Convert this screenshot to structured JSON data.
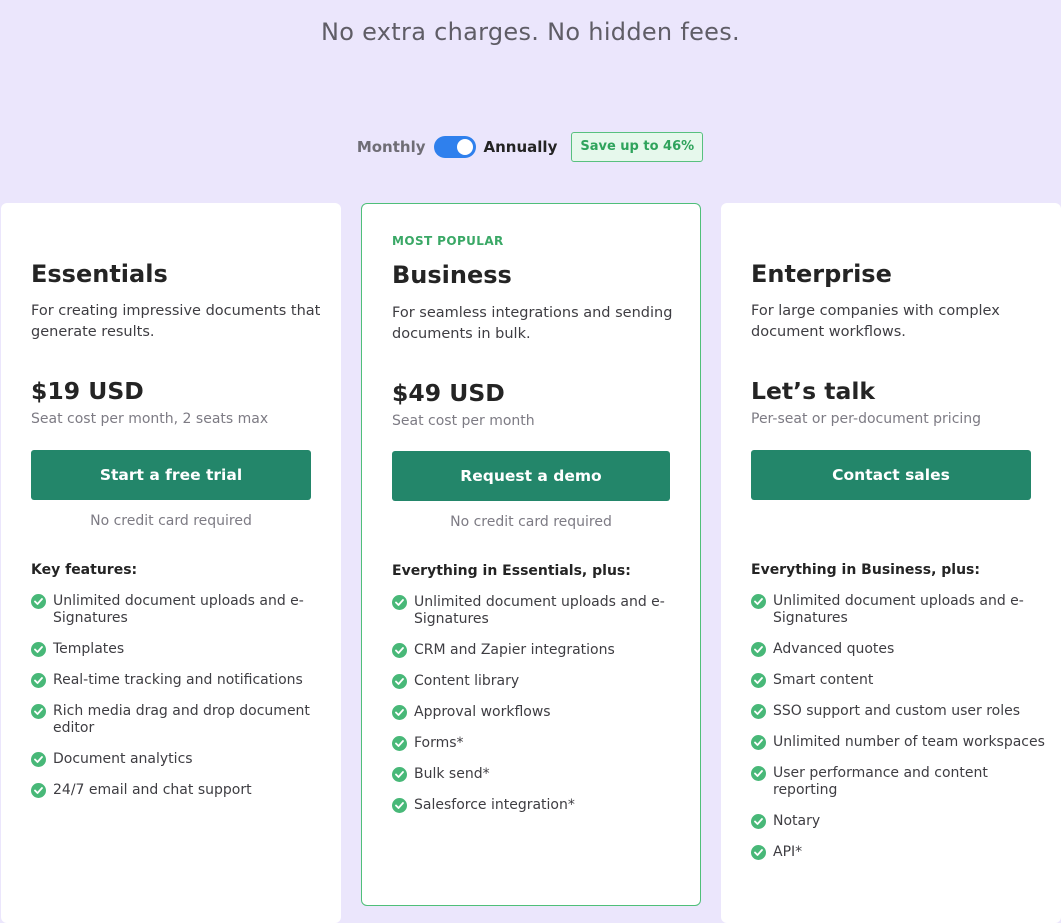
{
  "subtitle": "No extra charges. No hidden fees.",
  "billing": {
    "monthly_label": "Monthly",
    "annually_label": "Annually",
    "save_badge": "Save up to 46%",
    "selected": "Annually"
  },
  "colors": {
    "accent": "#23866a",
    "toggle": "#2f80ed",
    "check": "#48b878",
    "background": "#ebe6fc"
  },
  "plans": [
    {
      "badge": "",
      "name": "Essentials",
      "description": "For creating impressive documents that generate results.",
      "price": "$19 USD",
      "price_note": "Seat cost per month, 2 seats max",
      "cta": "Start a free trial",
      "cta_note": "No credit card required",
      "features_heading": "Key features:",
      "features": [
        "Unlimited document uploads and e-Signatures",
        "Templates",
        "Real-time tracking and notifications",
        "Rich media drag and drop document editor",
        "Document analytics",
        "24/7 email and chat support"
      ]
    },
    {
      "badge": "MOST POPULAR",
      "name": "Business",
      "description": "For seamless integrations and sending documents in bulk.",
      "price": "$49 USD",
      "price_note": "Seat cost per month",
      "cta": "Request a demo",
      "cta_note": "No credit card required",
      "features_heading": "Everything in Essentials, plus:",
      "features": [
        "Unlimited document uploads and e-Signatures",
        "CRM and Zapier integrations",
        "Content library",
        "Approval workflows",
        "Forms*",
        "Bulk send*",
        "Salesforce integration*"
      ]
    },
    {
      "badge": "",
      "name": "Enterprise",
      "description": "For large companies with complex document workflows.",
      "price": "Let’s talk",
      "price_note": "Per-seat or per-document pricing",
      "cta": "Contact sales",
      "cta_note": "",
      "features_heading": "Everything in Business, plus:",
      "features": [
        "Unlimited document uploads and e-Signatures",
        "Advanced quotes",
        "Smart content",
        "SSO support and custom user roles",
        "Unlimited number of team workspaces",
        "User performance and content reporting",
        "Notary",
        "API*"
      ]
    }
  ]
}
